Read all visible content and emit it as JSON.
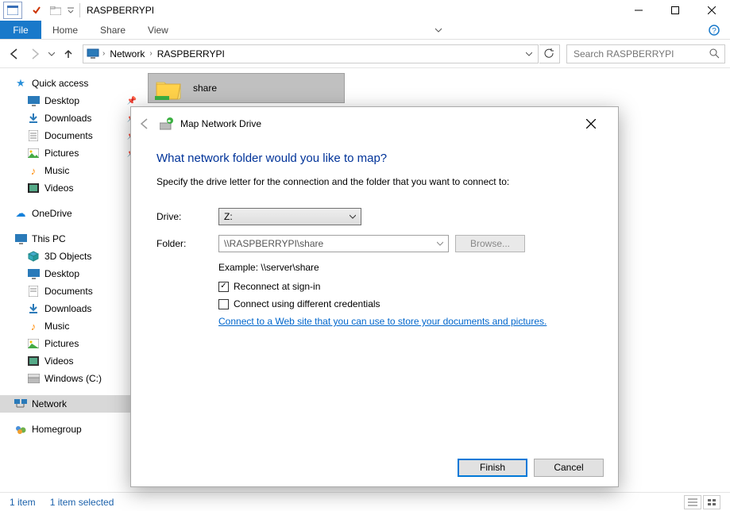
{
  "title": "RASPBERRYPI",
  "ribbon": {
    "file": "File",
    "tabs": [
      "Home",
      "Share",
      "View"
    ]
  },
  "nav": {
    "crumbs": [
      "Network",
      "RASPBERRYPI"
    ],
    "search_placeholder": "Search RASPBERRYPI"
  },
  "sidebar": {
    "quick_access": "Quick access",
    "quick_items": [
      "Desktop",
      "Downloads",
      "Documents",
      "Pictures",
      "Music",
      "Videos"
    ],
    "onedrive": "OneDrive",
    "this_pc": "This PC",
    "pc_items": [
      "3D Objects",
      "Desktop",
      "Documents",
      "Downloads",
      "Music",
      "Pictures",
      "Videos",
      "Windows (C:)"
    ],
    "network": "Network",
    "homegroup": "Homegroup"
  },
  "content_item": "share",
  "status": {
    "left": "1 item",
    "right": "1 item selected"
  },
  "wizard": {
    "title": "Map Network Drive",
    "heading": "What network folder would you like to map?",
    "sub": "Specify the drive letter for the connection and the folder that you want to connect to:",
    "drive_label": "Drive:",
    "drive_value": "Z:",
    "folder_label": "Folder:",
    "folder_value": "\\\\RASPBERRYPI\\share",
    "browse": "Browse...",
    "example": "Example: \\\\server\\share",
    "chk_reconnect": "Reconnect at sign-in",
    "chk_creds": "Connect using different credentials",
    "link": "Connect to a Web site that you can use to store your documents and pictures.",
    "finish": "Finish",
    "cancel": "Cancel"
  }
}
